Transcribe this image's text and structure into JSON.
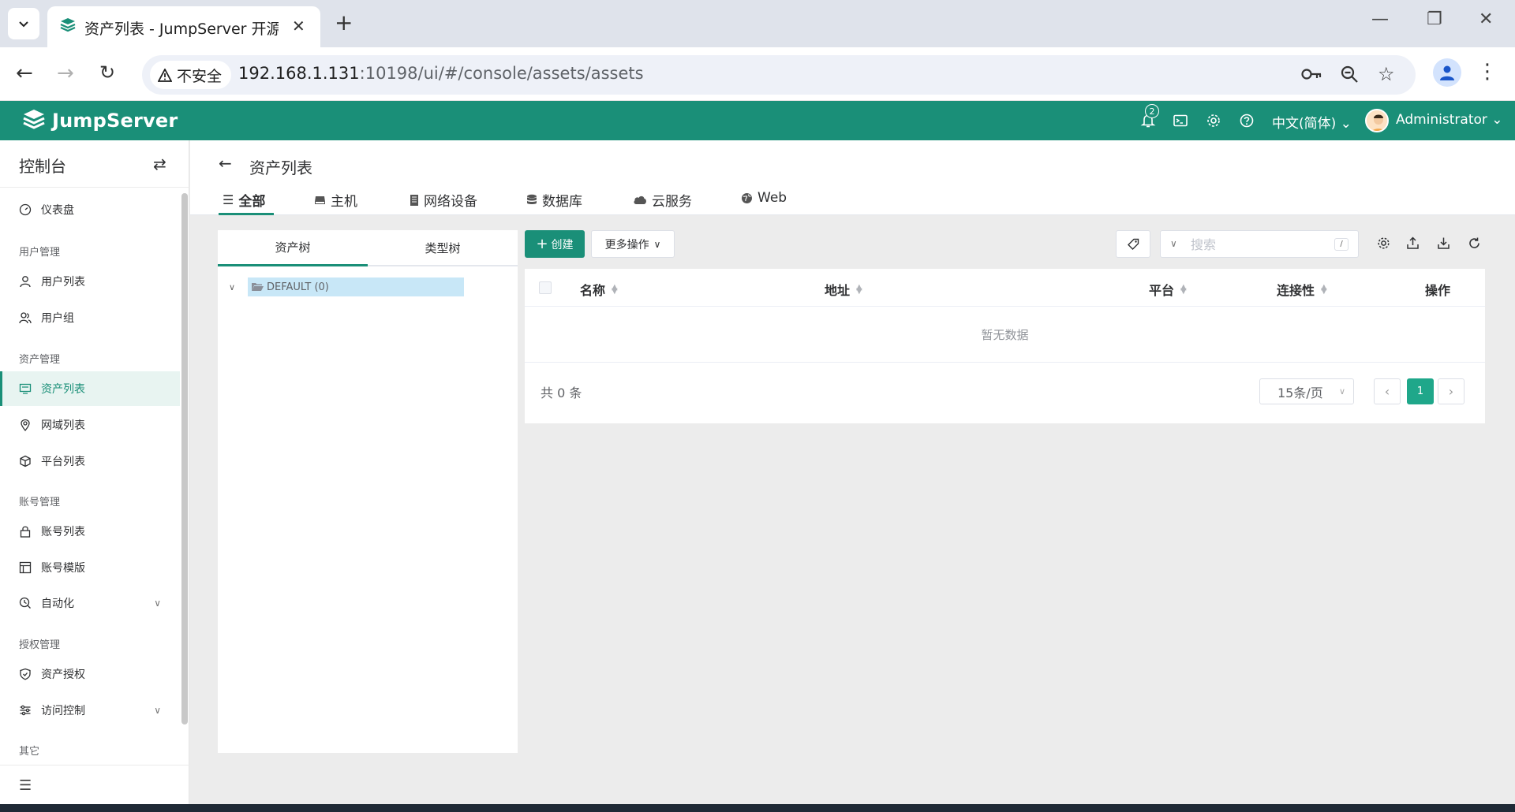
{
  "browser": {
    "tab_title": "资产列表 - JumpServer 开源堡垒机",
    "security_label": "不安全",
    "url_host": "192.168.1.131",
    "url_rest": ":10198/ui/#/console/assets/assets"
  },
  "header": {
    "logo_text": "JumpServer",
    "notification_count": "2",
    "language": "中文(简体)",
    "user_name": "Administrator"
  },
  "sidebar": {
    "title": "控制台",
    "dashboard": "仪表盘",
    "groups": {
      "user_mgmt": "用户管理",
      "asset_mgmt": "资产管理",
      "account_mgmt": "账号管理",
      "perm_mgmt": "授权管理",
      "other": "其它"
    },
    "items": {
      "user_list": "用户列表",
      "user_group": "用户组",
      "asset_list": "资产列表",
      "zone_list": "网域列表",
      "platform_list": "平台列表",
      "account_list": "账号列表",
      "account_template": "账号模版",
      "automation": "自动化",
      "asset_perm": "资产授权",
      "access_control": "访问控制"
    }
  },
  "page": {
    "title": "资产列表",
    "tabs": [
      "全部",
      "主机",
      "网络设备",
      "数据库",
      "云服务",
      "Web"
    ]
  },
  "tree": {
    "tabs": [
      "资产树",
      "类型树"
    ],
    "root_node": "DEFAULT (0)"
  },
  "toolbar": {
    "create_label": "创建",
    "more_label": "更多操作",
    "search_placeholder": "搜索",
    "search_shortcut": "/"
  },
  "table": {
    "columns": [
      "名称",
      "地址",
      "平台",
      "连接性",
      "操作"
    ],
    "empty_text": "暂无数据",
    "total_text": "共 0 条",
    "page_size": "15条/页",
    "current_page": "1"
  },
  "colors": {
    "brand": "#1a8f78",
    "active_bg": "#e8f4f1",
    "tree_highlight": "#c8e7f7"
  }
}
